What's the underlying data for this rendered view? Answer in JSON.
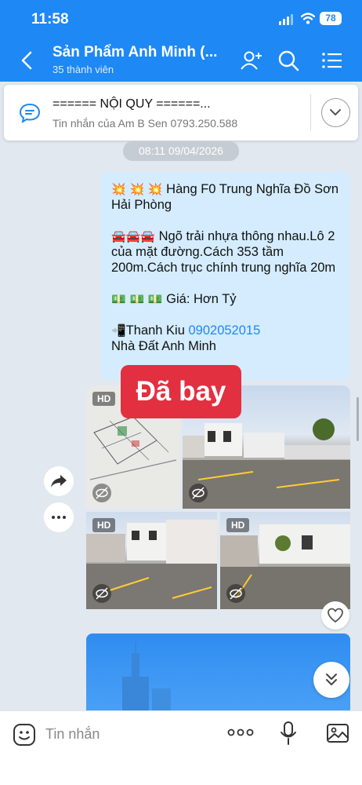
{
  "status_bar": {
    "time": "11:58",
    "battery": "78"
  },
  "header": {
    "title": "Sản Phẩm Anh Minh (...",
    "subtitle": "35 thành viên"
  },
  "pinned": {
    "title": "====== NỘI QUY ======...",
    "subtitle": "Tin nhắn của Am B Sen 0793.250.588"
  },
  "timestamp": "08:11 09/04/2026",
  "message": {
    "line1": "Hàng F0 Trung Nghĩa Đồ Sơn Hải Phòng",
    "line2": "Ngõ trải nhựa thông nhau.Lô 2 của mặt đường.Cách 353 tầm 200m.Cách trục chính trung nghĩa 20m",
    "line3": "Giá: Hơn Tỷ",
    "contact_name": "Thanh Kiu",
    "contact_phone": "0902052015",
    "line5": "Nhà Đất Anh Minh",
    "emoji_fire": "💥 💥 💥",
    "emoji_car": "🚘🚘🚘",
    "emoji_money": "💵 💵 💵",
    "emoji_phone": "📲"
  },
  "sold_label": "Đã bay",
  "images": {
    "hd_label": "HD"
  },
  "input_bar": {
    "placeholder": "Tin nhắn"
  },
  "colors": {
    "header": "#1e88f5",
    "bubble": "#d4ecfd",
    "sold": "#e23041",
    "link": "#1e88f5"
  }
}
